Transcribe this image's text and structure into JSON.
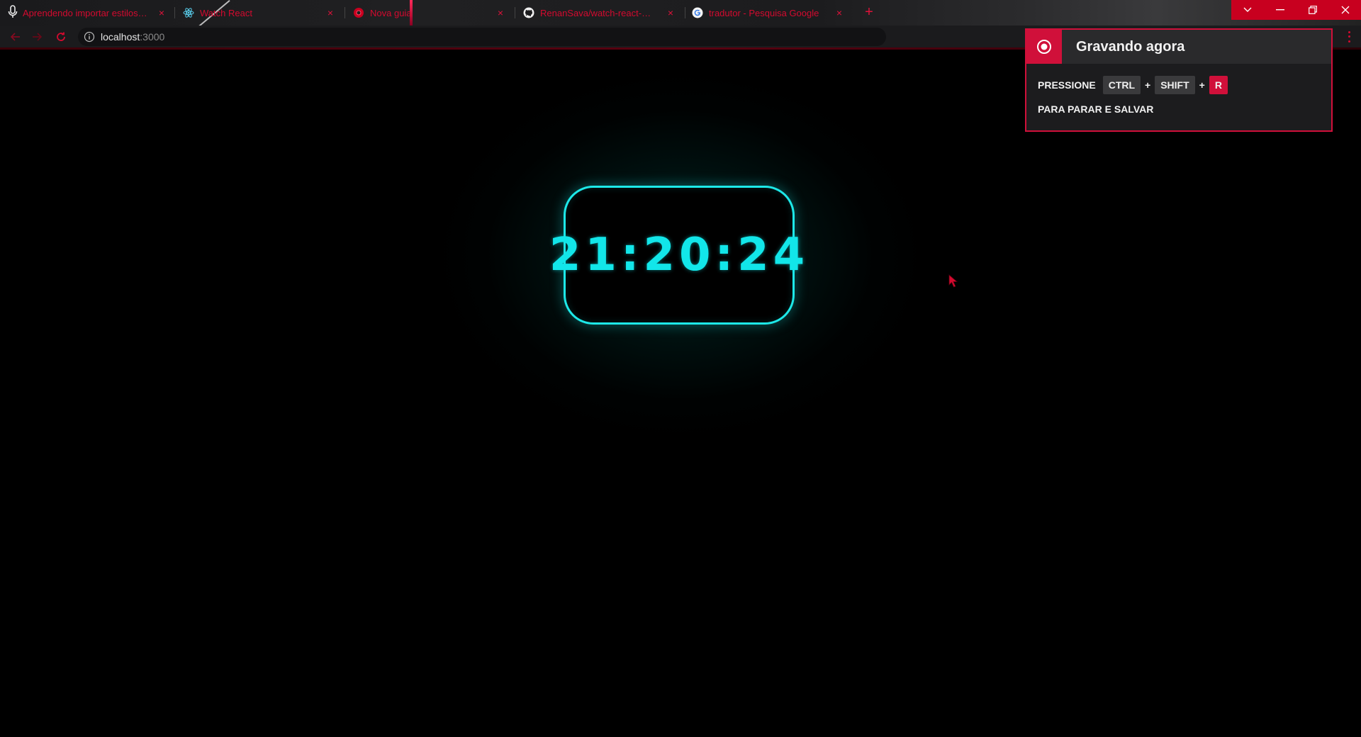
{
  "browser": {
    "tabs": [
      {
        "title": "Aprendendo importar estilos e c",
        "favicon": "mic-tab-icon"
      },
      {
        "title": "Watch React",
        "favicon": "react-icon"
      },
      {
        "title": "Nova guia",
        "favicon": "chrome-icon"
      },
      {
        "title": "RenanSava/watch-react-date",
        "favicon": "github-icon"
      },
      {
        "title": "tradutor - Pesquisa Google",
        "favicon": "google-icon"
      }
    ],
    "new_tab_label": "+",
    "close_glyph": "×",
    "address": {
      "host": "localhost",
      "port": ":3000"
    }
  },
  "page": {
    "clock_time": "21:20:24"
  },
  "recording": {
    "title": "Gravando agora",
    "press_label": "PRESSIONE",
    "keys": [
      "CTRL",
      "SHIFT",
      "R"
    ],
    "plus": "+",
    "footer": "PARA PARAR E SALVAR"
  },
  "colors": {
    "accent": "#d0103a",
    "clock_cyan": "#12e6e9",
    "background": "#000000"
  }
}
